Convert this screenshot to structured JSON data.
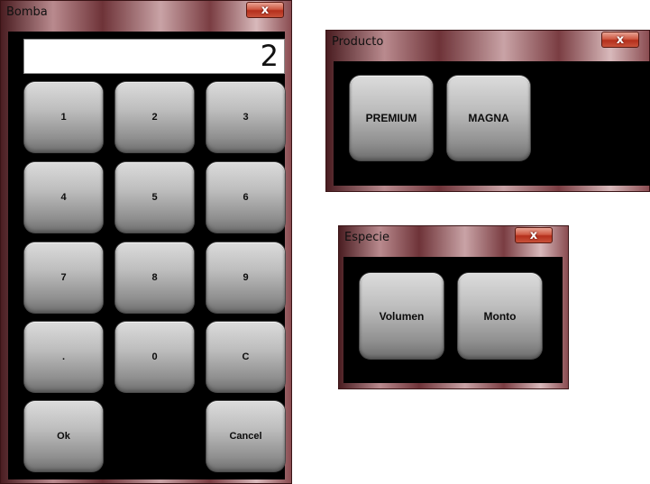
{
  "bomba": {
    "title": "Bomba",
    "display_value": "2",
    "keys": [
      "1",
      "2",
      "3",
      "4",
      "5",
      "6",
      "7",
      "8",
      "9",
      ".",
      "0",
      "C"
    ],
    "ok_label": "Ok",
    "cancel_label": "Cancel"
  },
  "producto": {
    "title": "Producto",
    "options": [
      "PREMIUM",
      "MAGNA"
    ]
  },
  "especie": {
    "title": "Especie",
    "options": [
      "Volumen",
      "Monto"
    ]
  },
  "close_glyph": "x",
  "colors": {
    "client_background": "#000000",
    "button_face": "#bdbdbd",
    "close_button": "#c8513a"
  }
}
